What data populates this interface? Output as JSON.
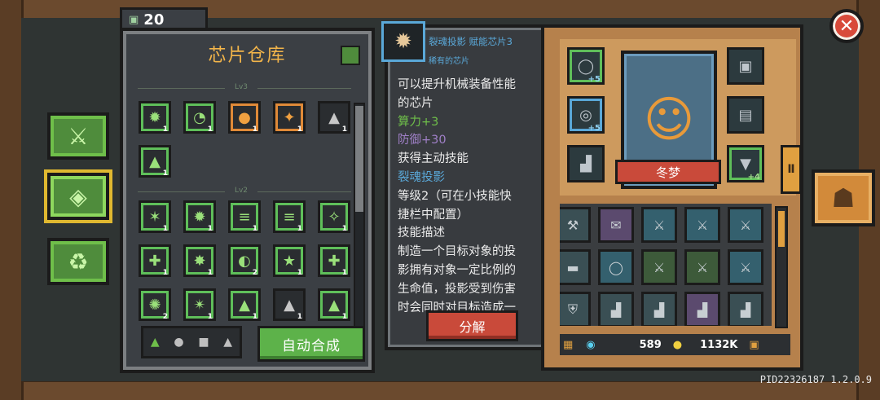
{
  "warehouse": {
    "count": "20",
    "title": "芯片仓库",
    "lv3_label": "Lv3",
    "lv2_label": "Lv2",
    "auto_combine": "自动合成"
  },
  "chips_lv3": [
    {
      "icon": "✹",
      "count": "1",
      "border": "green"
    },
    {
      "icon": "◔",
      "count": "1",
      "border": "green"
    },
    {
      "icon": "●",
      "count": "1",
      "border": "orange"
    },
    {
      "icon": "✦",
      "count": "1",
      "border": "orange"
    },
    {
      "icon": "▲",
      "count": "1",
      "border": "none"
    },
    {
      "icon": "▲",
      "count": "1",
      "border": "green"
    }
  ],
  "chips_lv2": [
    {
      "icon": "✶",
      "count": "1",
      "border": "green"
    },
    {
      "icon": "✹",
      "count": "1",
      "border": "green"
    },
    {
      "icon": "≡",
      "count": "1",
      "border": "green"
    },
    {
      "icon": "≡",
      "count": "1",
      "border": "green"
    },
    {
      "icon": "✧",
      "count": "1",
      "border": "green"
    },
    {
      "icon": "✚",
      "count": "1",
      "border": "green"
    },
    {
      "icon": "✸",
      "count": "1",
      "border": "green"
    },
    {
      "icon": "◐",
      "count": "2",
      "border": "green"
    },
    {
      "icon": "★",
      "count": "1",
      "border": "green"
    },
    {
      "icon": "✚",
      "count": "1",
      "border": "green"
    },
    {
      "icon": "✺",
      "count": "2",
      "border": "green"
    },
    {
      "icon": "✴",
      "count": "1",
      "border": "green"
    },
    {
      "icon": "▲",
      "count": "1",
      "border": "green"
    },
    {
      "icon": "▲",
      "count": "1",
      "border": "none"
    },
    {
      "icon": "▲",
      "count": "1",
      "border": "green"
    }
  ],
  "filter_icons": [
    "▲",
    "●",
    "■",
    "▲"
  ],
  "tooltip": {
    "name": "裂魂投影 赋能芯片3",
    "rarity": "稀有的芯片",
    "line1": "可以提升机械装备性能",
    "line2": "的芯片",
    "stat1": "算力+3",
    "stat2": "防御+30",
    "active_skill": "获得主动技能",
    "skill_name": "裂魂投影",
    "level_line1": "等级2（可在小技能快",
    "level_line2": "捷栏中配置）",
    "desc_title": "技能描述",
    "desc1": "制造一个目标对象的投",
    "desc2": "影拥有对象一定比例的",
    "desc3": "生命值，投影受到伤害",
    "desc4": "时会同时对目标造成一",
    "decompose": "分解"
  },
  "character": {
    "name": "冬梦",
    "slot_plus_1": "+5",
    "slot_plus_2": "+5",
    "slot_plus_3": "+4"
  },
  "currency": {
    "gems": "589",
    "coins": "1132K"
  },
  "version": "PID22326187 1.2.0.9"
}
